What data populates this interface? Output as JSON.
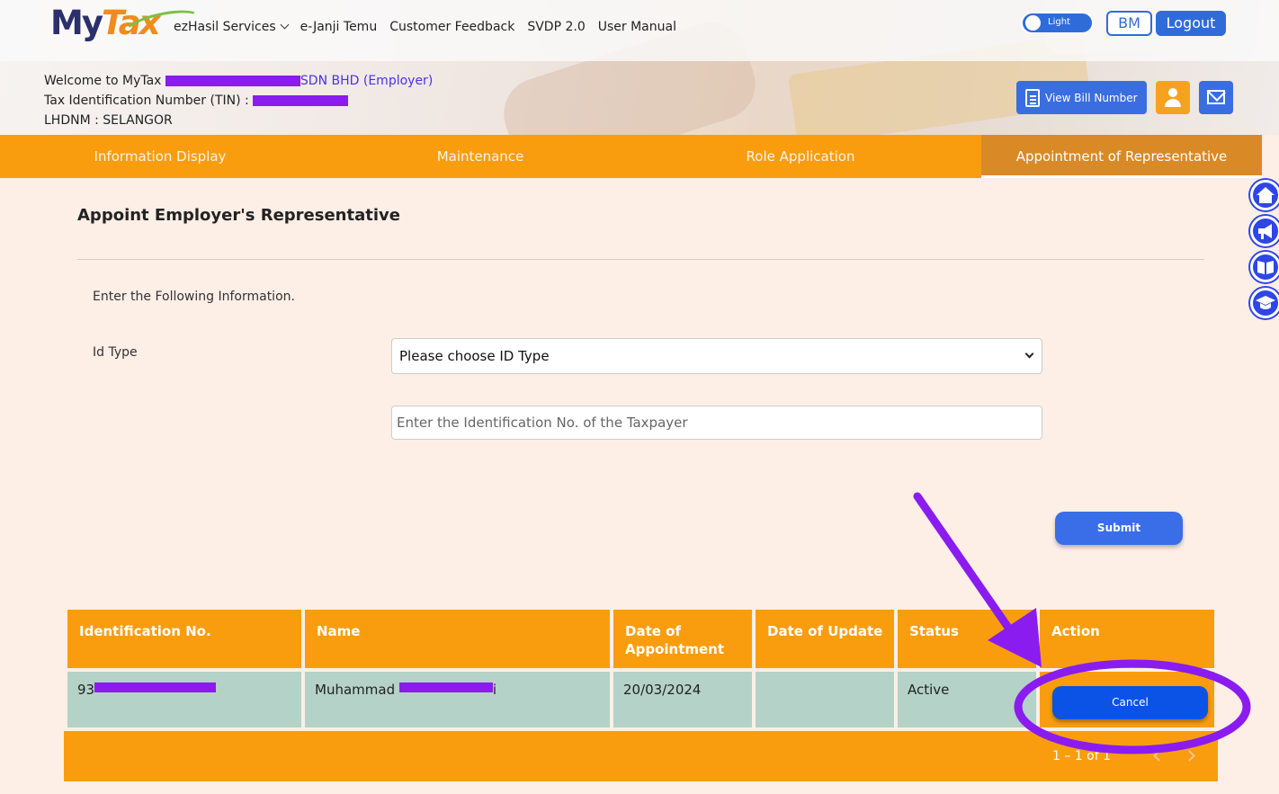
{
  "logo": {
    "my": "My",
    "tax": "Tax"
  },
  "nav": {
    "ezhasil": "ezHasil Services",
    "ejanji": "e-Janji Temu",
    "feedback": "Customer Feedback",
    "svdp": "SVDP 2.0",
    "manual": "User Manual"
  },
  "header": {
    "theme_label": "Light",
    "bm_label": "BM",
    "logout_label": "Logout",
    "bill_label": "View Bill Number"
  },
  "welcome": {
    "line1_prefix": "Welcome to MyTax",
    "line1_suffix": "SDN BHD (Employer)",
    "line2_prefix": "Tax Identification Number (TIN) :",
    "line3": "LHDNM : SELANGOR"
  },
  "tabs": [
    {
      "label": "Information Display"
    },
    {
      "label": "Maintenance"
    },
    {
      "label": "Role Application"
    },
    {
      "label": "Appointment of Representative"
    }
  ],
  "side_icons": [
    "home-icon",
    "megaphone-icon",
    "book-icon",
    "graduation-cap-icon"
  ],
  "form": {
    "title": "Appoint Employer's Representative",
    "intro": "Enter the Following Information.",
    "id_type_label": "Id Type",
    "id_type_value": "Please choose ID Type",
    "id_no_placeholder": "Enter the Identification No. of the Taxpayer",
    "submit_label": "Submit"
  },
  "table": {
    "headers": [
      "Identification No.",
      "Name",
      "Date of Appointment",
      "Date of Update",
      "Status",
      "Action"
    ],
    "rows": [
      {
        "id": "93",
        "name": "Muhammad",
        "name_end": "i",
        "date_appointment": "20/03/2024",
        "date_update": "",
        "status": "Active",
        "action_label": "Cancel"
      }
    ],
    "pagination": "1 – 1 of 1"
  },
  "colors": {
    "accent_orange": "#f99d0f",
    "primary_blue": "#3a6ee8",
    "annotation_purple": "#8a1cf0",
    "row_teal": "#b4d2c8"
  }
}
